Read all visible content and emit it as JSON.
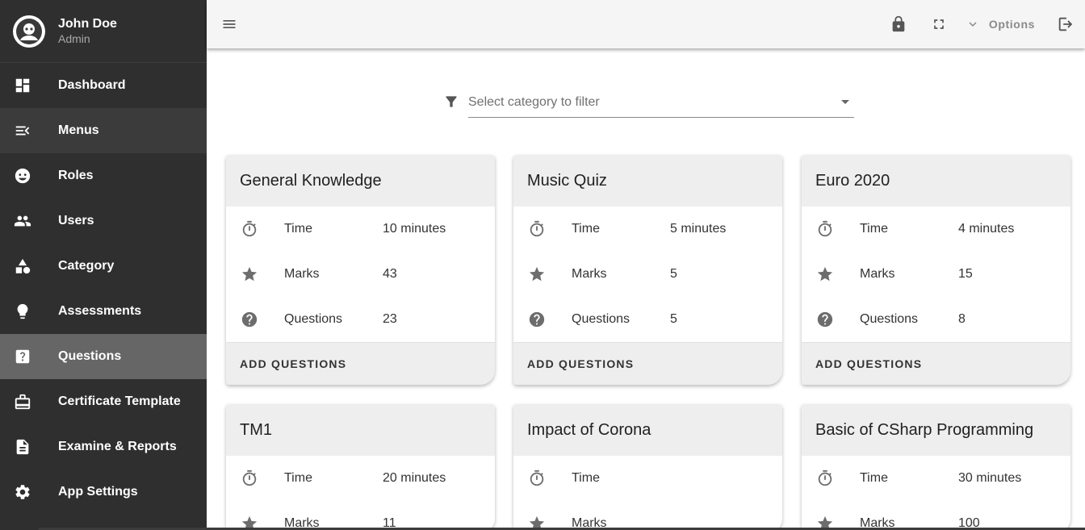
{
  "profile": {
    "name": "John Doe",
    "role": "Admin"
  },
  "sidebar": {
    "items": [
      {
        "label": "Dashboard",
        "icon": "dashboard-icon"
      },
      {
        "label": "Menus",
        "icon": "menu-open-icon"
      },
      {
        "label": "Roles",
        "icon": "mask-icon"
      },
      {
        "label": "Users",
        "icon": "people-icon"
      },
      {
        "label": "Category",
        "icon": "shapes-icon"
      },
      {
        "label": "Assessments",
        "icon": "lightbulb-icon"
      },
      {
        "label": "Questions",
        "icon": "question-box-icon"
      },
      {
        "label": "Certificate Template",
        "icon": "certificate-icon"
      },
      {
        "label": "Examine & Reports",
        "icon": "document-icon"
      },
      {
        "label": "App Settings",
        "icon": "gear-icon"
      }
    ],
    "active": "Questions"
  },
  "topbar": {
    "options_label": "Options"
  },
  "filter": {
    "placeholder": "Select category to filter"
  },
  "cards": [
    {
      "title": "General Knowledge",
      "time_label": "Time",
      "time": "10 minutes",
      "marks_label": "Marks",
      "marks": "43",
      "questions_label": "Questions",
      "questions": "23",
      "action": "ADD QUESTIONS"
    },
    {
      "title": "Music Quiz",
      "time_label": "Time",
      "time": "5 minutes",
      "marks_label": "Marks",
      "marks": "5",
      "questions_label": "Questions",
      "questions": "5",
      "action": "ADD QUESTIONS"
    },
    {
      "title": "Euro 2020",
      "time_label": "Time",
      "time": "4 minutes",
      "marks_label": "Marks",
      "marks": "15",
      "questions_label": "Questions",
      "questions": "8",
      "action": "ADD QUESTIONS"
    },
    {
      "title": "TM1",
      "time_label": "Time",
      "time": "20 minutes",
      "marks_label": "Marks",
      "marks": "11"
    },
    {
      "title": "Impact of Corona",
      "time_label": "Time",
      "time": "",
      "marks_label": "Marks",
      "marks": ""
    },
    {
      "title": "Basic of CSharp Programming",
      "time_label": "Time",
      "time": "30 minutes",
      "marks_label": "Marks",
      "marks": "100"
    }
  ],
  "colors": {
    "sidebar_bg": "#2f2f2f",
    "active_item_bg": "#666666",
    "card_header_bg": "#eeeeee"
  }
}
